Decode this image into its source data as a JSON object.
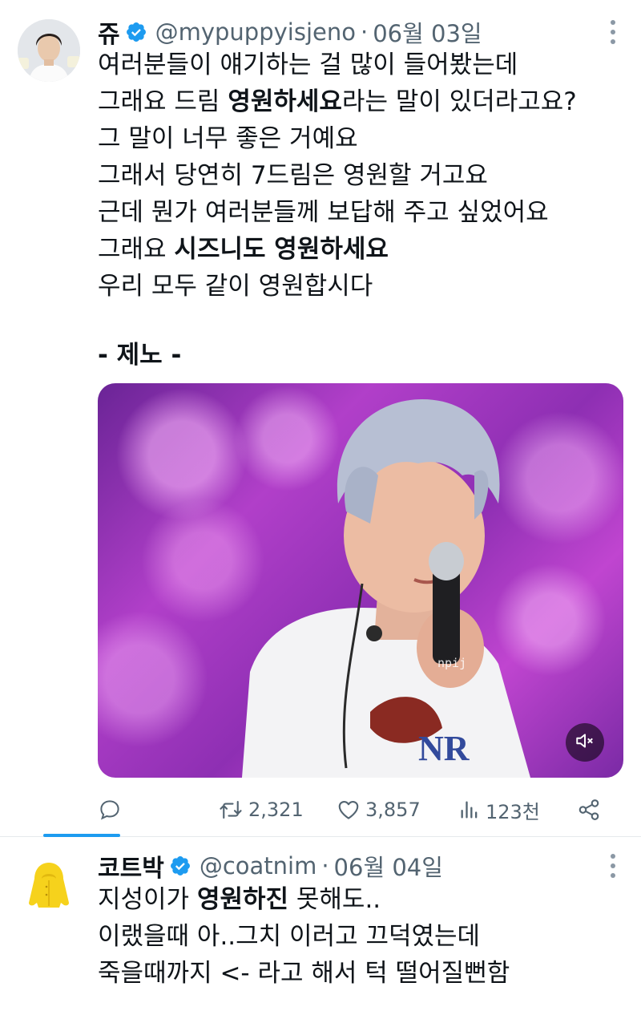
{
  "colors": {
    "verified": "#1d9bf0",
    "secondary_text": "#536471",
    "primary_text": "#0f1419"
  },
  "tweets": [
    {
      "display_name": "쥬",
      "handle": "@mypuppyisjeno",
      "separator": "·",
      "date": "06월 03일",
      "lines": [
        [
          {
            "t": "여러분들이 얘기하는 걸 많이 들어봤는데",
            "b": false
          }
        ],
        [
          {
            "t": "그래요 드림 ",
            "b": false
          },
          {
            "t": "영원하세요",
            "b": true
          },
          {
            "t": "라는 말이 있더라고요?",
            "b": false
          }
        ],
        [
          {
            "t": "그 말이 너무 좋은 거예요",
            "b": false
          }
        ],
        [
          {
            "t": "그래서 당연히 7드림은 영원할 거고요",
            "b": false
          }
        ],
        [
          {
            "t": "근데 뭔가 여러분들께 보답해 주고 싶었어요",
            "b": false
          }
        ],
        [
          {
            "t": "그래요 ",
            "b": false
          },
          {
            "t": "시즈니도 영원하세요",
            "b": true
          }
        ],
        [
          {
            "t": "우리 모두 같이 영원합시다",
            "b": false
          }
        ]
      ],
      "signature": "- 제노 -",
      "media": {
        "watermark": "npij",
        "mute_icon": "speaker-muted-icon"
      },
      "actions": {
        "reply_icon": "reply-bubble-icon",
        "retweets": "2,321",
        "likes": "3,857",
        "views": "123천",
        "share_icon": "share-icon"
      }
    },
    {
      "display_name": "코트박",
      "handle": "@coatnim",
      "separator": "·",
      "date": "06월 04일",
      "lines": [
        [
          {
            "t": "지성이가 ",
            "b": false
          },
          {
            "t": "영원하진",
            "b": true
          },
          {
            "t": " 못해도..",
            "b": false
          }
        ],
        [
          {
            "t": "이랬을때 아..그치 이러고 끄덕였는데",
            "b": false
          }
        ],
        [
          {
            "t": "죽을때까지 <- 라고 해서 턱 떨어질뻔함",
            "b": false
          }
        ]
      ],
      "avatar_icon": "yellow-raincoat-icon"
    }
  ]
}
